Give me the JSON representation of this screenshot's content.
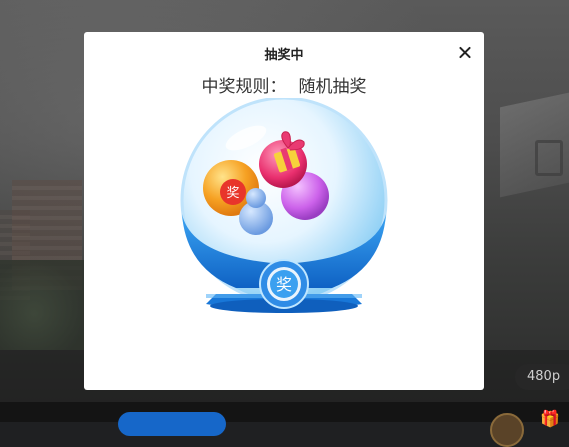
{
  "modal": {
    "title": "抽奖中",
    "rule_label": "中奖规则：",
    "rule_value": "随机抽奖",
    "machine_badge": "奖",
    "ball_label": "奖"
  },
  "player": {
    "quality": "480p"
  },
  "icons": {
    "close": "close-icon",
    "gift": "gift-icon"
  },
  "colors": {
    "modal_bg": "#ffffff",
    "machine_blue": "#1a7fe0",
    "globe": "#cfeaff",
    "ball_orange": "#f39a21",
    "ball_pink": "#e93a72",
    "ball_purple": "#c85ee6",
    "bottom_button": "#1667c9"
  }
}
